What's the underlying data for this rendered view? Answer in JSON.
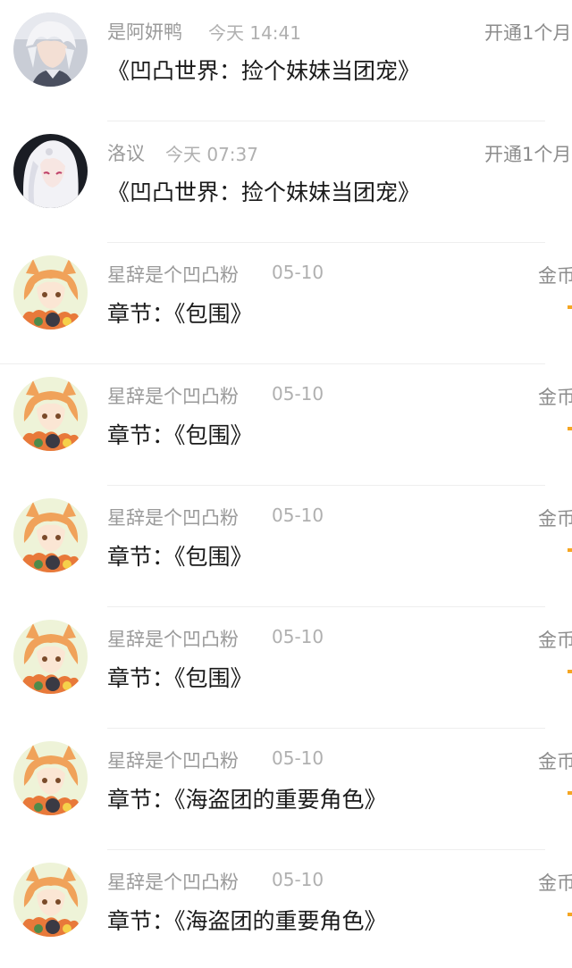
{
  "messages": [
    {
      "user": "是阿妍鸭",
      "time": "今天 14:41",
      "content": "《凹凸世界：捡个妹妹当团宠》",
      "right": "开通1个月",
      "avatar": "white-haired-boy-avatar"
    },
    {
      "user": "洛议",
      "time": "今天 07:37",
      "content": "《凹凸世界：捡个妹妹当团宠》",
      "right": "开通1个月",
      "avatar": "white-haired-girl-avatar"
    },
    {
      "user": "星辞是个凹凸粉",
      "time": "05-10",
      "content": "章节：《包围》",
      "right": "金币",
      "avatar": "orange-fox-girl-avatar"
    },
    {
      "user": "星辞是个凹凸粉",
      "time": "05-10",
      "content": "章节：《包围》",
      "right": "金币",
      "avatar": "orange-fox-girl-avatar"
    },
    {
      "user": "星辞是个凹凸粉",
      "time": "05-10",
      "content": "章节：《包围》",
      "right": "金币",
      "avatar": "orange-fox-girl-avatar"
    },
    {
      "user": "星辞是个凹凸粉",
      "time": "05-10",
      "content": "章节：《包围》",
      "right": "金币",
      "avatar": "orange-fox-girl-avatar"
    },
    {
      "user": "星辞是个凹凸粉",
      "time": "05-10",
      "content": "章节：《海盗团的重要角色》",
      "right": "金币",
      "avatar": "orange-fox-girl-avatar"
    },
    {
      "user": "星辞是个凹凸粉",
      "time": "05-10",
      "content": "章节：《海盗团的重要角色》",
      "right": "金币",
      "avatar": "orange-fox-girl-avatar"
    }
  ],
  "colors": {
    "username": "#9a9a9a",
    "timestamp": "#b0b0b0",
    "content": "#1a1a1a",
    "accent": "#f5a623"
  }
}
